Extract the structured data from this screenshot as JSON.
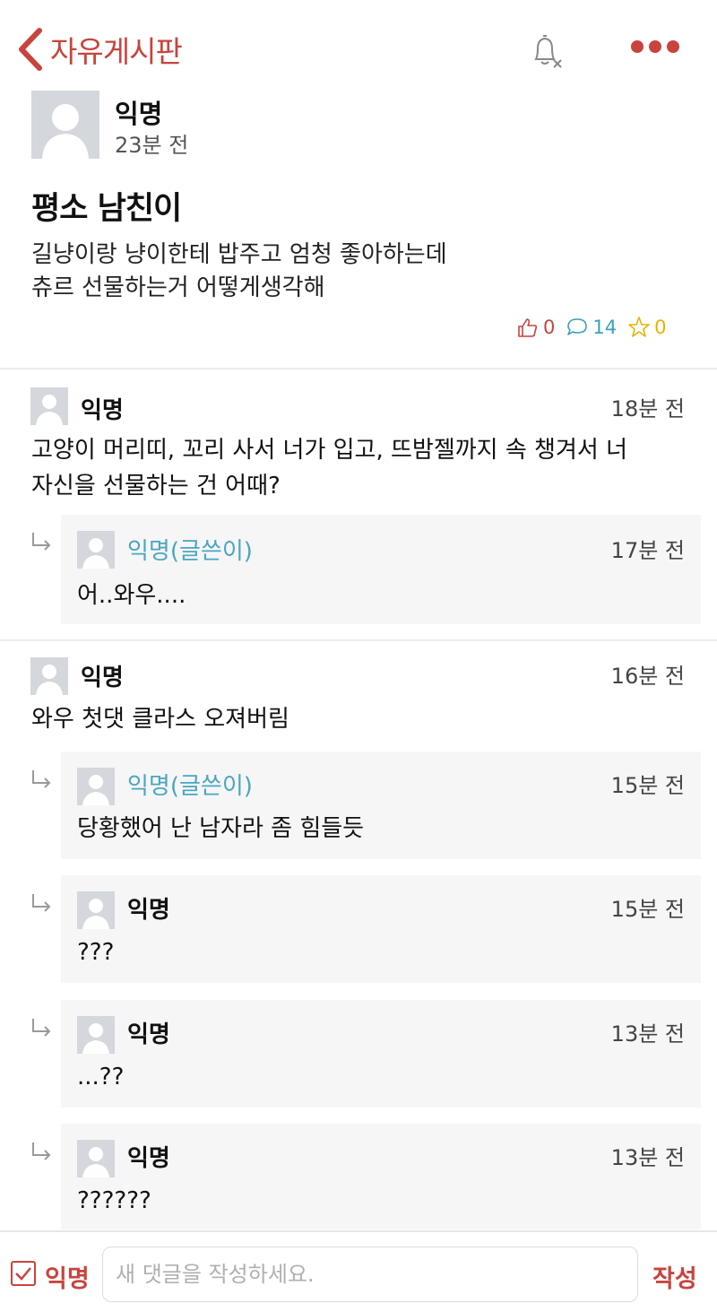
{
  "header": {
    "back_label": "자유게시판"
  },
  "post": {
    "author": "익명",
    "time": "23분 전",
    "title": "평소 남친이",
    "body_lines": [
      "길냥이랑 냥이한테 밥주고 엄청 좋아하는데",
      "츄르 선물하는거 어떻게생각해"
    ],
    "likes": "0",
    "comments": "14",
    "scraps": "0"
  },
  "comments": [
    {
      "author": "익명",
      "time": "18분 전",
      "lines": [
        "고양이 머리띠, 꼬리 사서 너가 입고, 뜨밤젤까지 속 챙겨서 너",
        "자신을 선물하는 건 어때?"
      ],
      "replies": [
        {
          "author": "익명(글쓴이)",
          "time": "17분 전",
          "text": "어..와우...."
        }
      ]
    },
    {
      "author": "익명",
      "time": "16분 전",
      "lines": [
        "와우 첫댓 클라스 오져버림"
      ],
      "replies": [
        {
          "author": "익명(글쓴이)",
          "time": "15분 전",
          "text": "당황했어 난 남자라 좀 힘들듯"
        },
        {
          "author": "익명",
          "time": "15분 전",
          "text": "???"
        },
        {
          "author": "익명",
          "time": "13분 전",
          "text": "...??"
        },
        {
          "author": "익명",
          "time": "13분 전",
          "text": "??????"
        }
      ]
    }
  ],
  "composer": {
    "anon_label": "익명",
    "placeholder": "새 댓글을 작성하세요.",
    "submit_label": "작성"
  },
  "colors": {
    "accent": "#c8443c",
    "op_author": "#4aa6c2",
    "comment_count": "#3da0b8",
    "scrap": "#e5b300",
    "reply_bg": "#f6f6f6"
  },
  "icons": [
    "back-chevron-icon",
    "bell-off-icon",
    "more-dots-icon",
    "thumbs-up-icon",
    "speech-bubble-icon",
    "star-icon",
    "reply-arrow-icon",
    "checkbox-icon"
  ]
}
